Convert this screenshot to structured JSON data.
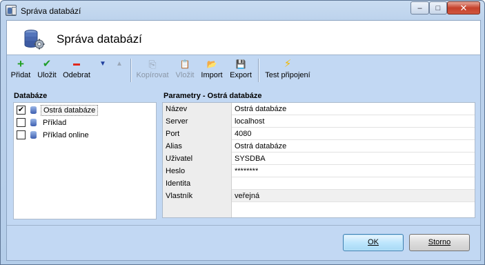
{
  "window": {
    "title": "Správa databází",
    "controls": {
      "minimize": "–",
      "maximize": "□",
      "close": "✕"
    }
  },
  "header": {
    "title": "Správa databází",
    "icon": "database-gear-icon"
  },
  "toolbar": {
    "add": {
      "label": "Přidat",
      "icon": "+",
      "color": "#21a021"
    },
    "save": {
      "label": "Uložit",
      "icon": "✔",
      "color": "#1f9d2a"
    },
    "remove": {
      "label": "Odebrat",
      "icon": "▬",
      "color": "#e0281c"
    },
    "move_down": {
      "icon": "▼",
      "color": "#1f3f9e"
    },
    "move_up": {
      "icon": "▲",
      "color": "#9aa7b8"
    },
    "copy": {
      "label": "Kopírovat",
      "icon": "⎘"
    },
    "paste": {
      "label": "Vložit",
      "icon": "📋"
    },
    "import": {
      "label": "Import",
      "icon": "📂"
    },
    "export": {
      "label": "Export",
      "icon": "💾"
    },
    "test": {
      "label": "Test připojení",
      "icon": "⚡",
      "color": "#f2b800"
    }
  },
  "databases": {
    "label": "Databáze",
    "items": [
      {
        "name": "Ostrá databáze",
        "checked": "✔",
        "selected": true
      },
      {
        "name": "Příklad",
        "checked": "",
        "selected": false
      },
      {
        "name": "Příklad online",
        "checked": "",
        "selected": false
      }
    ]
  },
  "parameters": {
    "label": "Parametry - Ostrá databáze",
    "rows": [
      {
        "key": "Název",
        "value": "Ostrá databáze"
      },
      {
        "key": "Server",
        "value": "localhost"
      },
      {
        "key": "Port",
        "value": "4080"
      },
      {
        "key": "Alias",
        "value": "Ostrá databáze"
      },
      {
        "key": "Uživatel",
        "value": "SYSDBA"
      },
      {
        "key": "Heslo",
        "value": "********"
      },
      {
        "key": "Identita",
        "value": ""
      },
      {
        "key": "Vlastník",
        "value": "veřejná"
      }
    ]
  },
  "buttons": {
    "ok": "OK",
    "cancel": "Storno"
  }
}
